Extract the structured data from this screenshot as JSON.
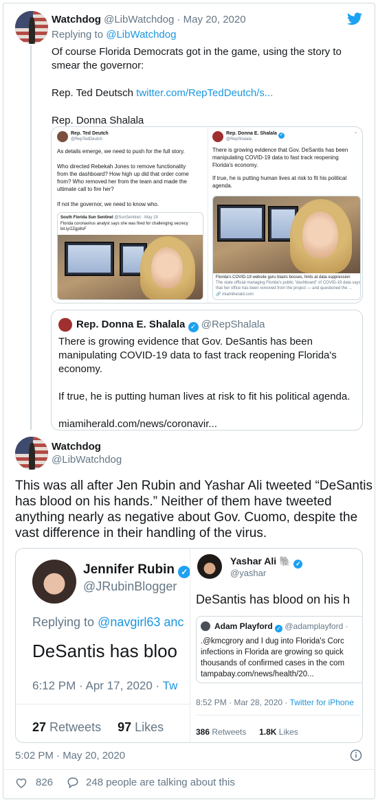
{
  "tweet1": {
    "name": "Watchdog",
    "handle": "@LibWatchdog",
    "sep_date": " · May 20, 2020",
    "replying_prefix": "Replying to ",
    "replying_to": "@LibWatchdog",
    "line1": "Of course Florida Democrats got in the game, using the story to",
    "line2": "smear the governor:",
    "rep1_prefix": "Rep. Ted Deutsch ",
    "rep1_link": "twitter.com/RepTedDeutch/s...",
    "rep2": "Rep. Donna Shalala"
  },
  "image_card": {
    "left": {
      "name": "Rep. Ted Deutch",
      "handle": "@RepTedDeutch",
      "p1": "As details emerge, we need to push for the full story.",
      "p2a": "Who directed Rebekah Jones to remove functionality",
      "p2b": "from the dashboard? How high up did that order come",
      "p2c": "from? Who removed her from the team and made the",
      "p2d": "ultimate call to fire her?",
      "p3": "If not the governor, we need to know who.",
      "quote_name": "South Florida Sun Sentinel",
      "quote_handle": "@SunSentinel · May 19",
      "quote_l1": "Florida coronavirus analyst says she was fired for challenging secrecy",
      "quote_l2": "bit.ly/2Zgp8sF"
    },
    "right": {
      "name": "Rep. Donna E. Shalala",
      "handle": "@RepShalala",
      "p1a": "There is growing evidence that Gov. DeSantis has been",
      "p1b": "manipulating COVID-19 data to fast track reopening",
      "p1c": "Florida's economy.",
      "p2a": "If true, he is putting human lives at risk to fit his political",
      "p2b": "agenda.",
      "cap1": "Florida's COVID-19 website guru blasts bosses, hints at data suppression",
      "cap2": "The state official managing Florida's public \"dashboard\" of COVID-19 data says",
      "cap3": "that her office has been removed from the project — and questioned the ...",
      "cap4": "miamiherald.com"
    }
  },
  "quote_card": {
    "name": "Rep. Donna E. Shalala",
    "handle": "@RepShalala",
    "l1": "There is growing evidence that Gov. DeSantis has been",
    "l2": "manipulating COVID-19 data to fast track reopening Florida's",
    "l3": "economy.",
    "l4": "If true, he is putting human lives at risk to fit his political agenda.",
    "link": "miamiherald.com/news/coronavir..."
  },
  "tweet2": {
    "name": "Watchdog",
    "handle": "@LibWatchdog",
    "l1": "This was all after Jen Rubin and Yashar Ali tweeted “DeSantis",
    "l2": "has blood on his hands.” Neither of them have tweeted",
    "l3": "anything nearly as negative about Gov. Cuomo, despite the",
    "l4": "vast difference in their handling of the virus."
  },
  "screenshot_card": {
    "left": {
      "name": "Jennifer Rubin",
      "handle": "@JRubinBlogger",
      "replying_prefix": "Replying to ",
      "replying_to": "@navgirl63 anc",
      "text": "DeSantis has bloo",
      "time": "6:12 PM · Apr 17, 2020 · ",
      "via": "Tw",
      "retweets_num": "27",
      "retweets_label": " Retweets",
      "likes_num": "97",
      "likes_label": " Likes"
    },
    "right": {
      "name": "Yashar Ali",
      "emoji": "🐘",
      "handle": "@yashar",
      "text": "DeSantis has blood on his h",
      "quote_name": "Adam Playford",
      "quote_handle": "@adamplayford ·",
      "q1": ".@kmcgrory and I dug into Florida's Corc",
      "q2": "infections in Florida are growing so quick",
      "q3": "thousands of confirmed cases in the com",
      "q4": "tampabay.com/news/health/20...",
      "time": "8:52 PM · Mar 28, 2020 · ",
      "via": "Twitter for iPhone",
      "retweets_num": "386",
      "retweets_label": " Retweets",
      "likes_num": "1.8K",
      "likes_label": " Likes"
    }
  },
  "footer": {
    "timestamp": "5:02 PM · May 20, 2020",
    "likes": "826",
    "talking": "248 people are talking about this"
  },
  "colors": {
    "link": "#1b95e0",
    "muted": "#657786",
    "border": "#cfd9de",
    "twitter": "#1da1f2"
  }
}
